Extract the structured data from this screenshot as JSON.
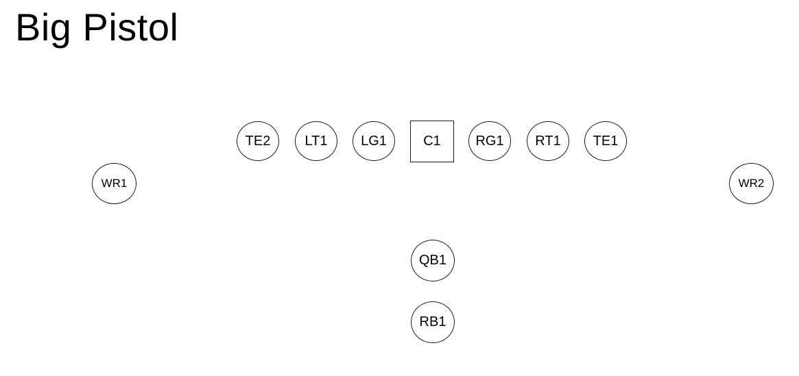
{
  "title": "Big Pistol",
  "players": {
    "te2": "TE2",
    "lt1": "LT1",
    "lg1": "LG1",
    "c1": "C1",
    "rg1": "RG1",
    "rt1": "RT1",
    "te1": "TE1",
    "wr1": "WR1",
    "wr2": "WR2",
    "qb1": "QB1",
    "rb1": "RB1"
  }
}
